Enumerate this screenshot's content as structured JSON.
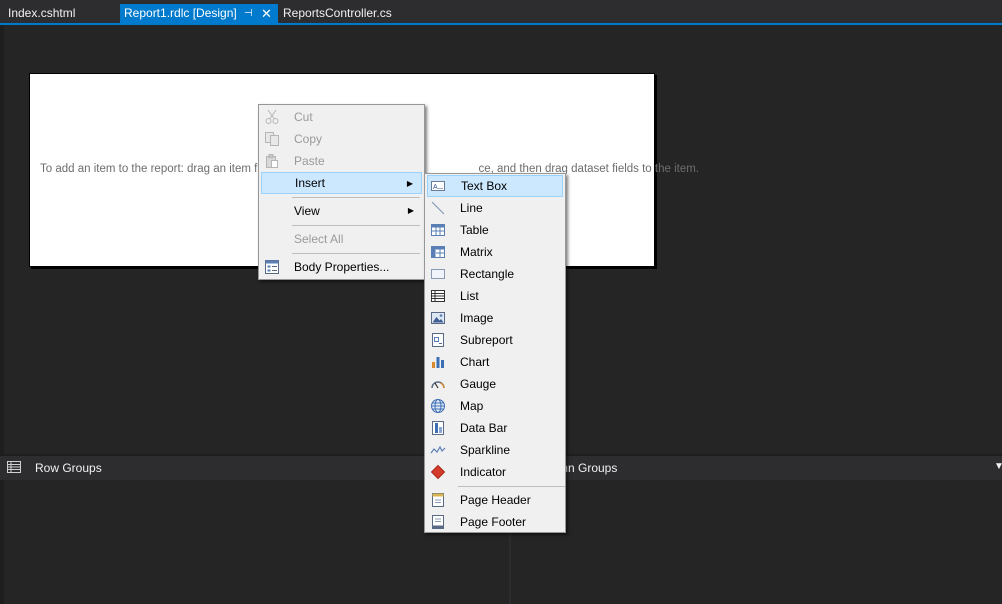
{
  "tabs": [
    {
      "label": "Index.cshtml",
      "active": false
    },
    {
      "label": "Report1.rdlc [Design]",
      "active": true
    },
    {
      "label": "ReportsController.cs",
      "active": false
    }
  ],
  "tab_icons": {
    "pin": "⊣",
    "close": "✕"
  },
  "report": {
    "hint": "To add an item to the report: drag an item fro                                                                  ce, and then drag dataset fields to the item."
  },
  "groups": {
    "row_label": "Row Groups",
    "col_label": "mn Groups"
  },
  "context_menu": {
    "cut": "Cut",
    "copy": "Copy",
    "paste": "Paste",
    "insert": "Insert",
    "view": "View",
    "select_all": "Select All",
    "body_properties": "Body Properties..."
  },
  "insert_submenu": [
    {
      "label": "Text Box",
      "icon": "textbox-icon"
    },
    {
      "label": "Line",
      "icon": "line-icon"
    },
    {
      "label": "Table",
      "icon": "table-icon"
    },
    {
      "label": "Matrix",
      "icon": "matrix-icon"
    },
    {
      "label": "Rectangle",
      "icon": "rectangle-icon"
    },
    {
      "label": "List",
      "icon": "list-icon"
    },
    {
      "label": "Image",
      "icon": "image-icon"
    },
    {
      "label": "Subreport",
      "icon": "subreport-icon"
    },
    {
      "label": "Chart",
      "icon": "chart-icon"
    },
    {
      "label": "Gauge",
      "icon": "gauge-icon"
    },
    {
      "label": "Map",
      "icon": "map-icon"
    },
    {
      "label": "Data Bar",
      "icon": "databar-icon"
    },
    {
      "label": "Sparkline",
      "icon": "sparkline-icon"
    },
    {
      "label": "Indicator",
      "icon": "indicator-icon"
    },
    {
      "label": "Page Header",
      "icon": "page-header-icon"
    },
    {
      "label": "Page Footer",
      "icon": "page-footer-icon"
    }
  ],
  "colors": {
    "accent": "#007acc",
    "menu_highlight": "#cce8ff",
    "background": "#1e1e1e"
  }
}
